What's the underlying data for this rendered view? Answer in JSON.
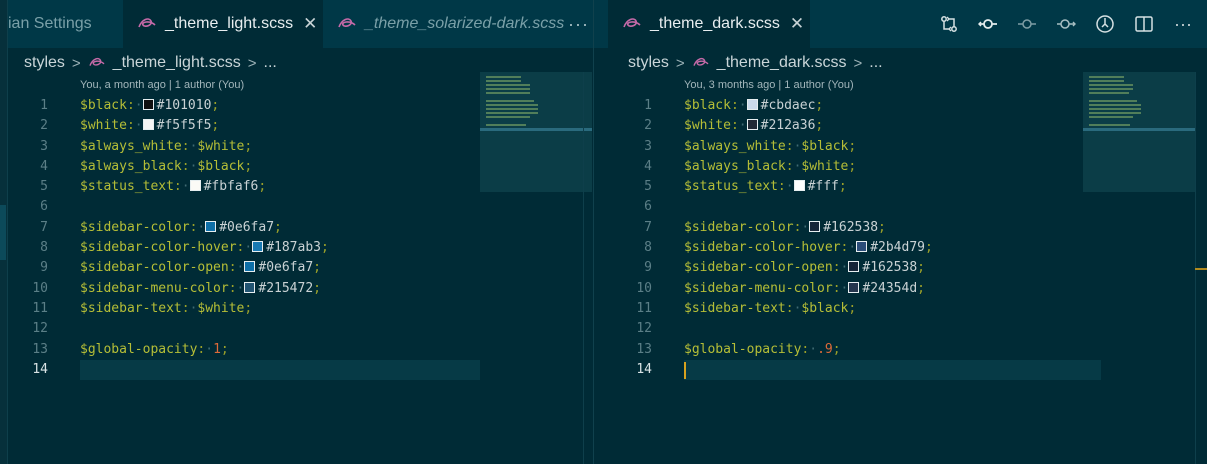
{
  "left": {
    "tabs": [
      {
        "label": "ian Settings",
        "active": false,
        "italic": false,
        "close": false
      },
      {
        "label": "_theme_light.scss",
        "active": true,
        "italic": false,
        "close": true
      },
      {
        "label": "_theme_solarized-dark.scss",
        "active": false,
        "italic": true,
        "close": false
      }
    ],
    "more": "···",
    "breadcrumb": {
      "folder": "styles",
      "file": "_theme_light.scss",
      "ellipsis": "..."
    },
    "blame": "You, a month ago | 1 author (You)",
    "lines": [
      {
        "n": "1",
        "var": "$black",
        "swatch": "#101010",
        "value": "#101010"
      },
      {
        "n": "2",
        "var": "$white",
        "swatch": "#f5f5f5",
        "value": "#f5f5f5"
      },
      {
        "n": "3",
        "var": "$always_white",
        "value": "$white"
      },
      {
        "n": "4",
        "var": "$always_black",
        "value": "$black"
      },
      {
        "n": "5",
        "var": "$status_text",
        "swatch": "#fbfaf6",
        "value": "#fbfaf6"
      },
      {
        "n": "6"
      },
      {
        "n": "7",
        "var": "$sidebar-color",
        "swatch": "#0e6fa7",
        "value": "#0e6fa7"
      },
      {
        "n": "8",
        "var": "$sidebar-color-hover",
        "swatch": "#187ab3",
        "value": "#187ab3"
      },
      {
        "n": "9",
        "var": "$sidebar-color-open",
        "swatch": "#0e6fa7",
        "value": "#0e6fa7"
      },
      {
        "n": "10",
        "var": "$sidebar-menu-color",
        "swatch": "#215472",
        "value": "#215472"
      },
      {
        "n": "11",
        "var": "$sidebar-text",
        "value": "$white"
      },
      {
        "n": "12"
      },
      {
        "n": "13",
        "var": "$global-opacity",
        "value": "1",
        "numeric": true
      },
      {
        "n": "14",
        "current": true
      }
    ]
  },
  "right": {
    "tab": {
      "label": "_theme_dark.scss",
      "close": true
    },
    "toolbar_icons": [
      "compare-changes-icon",
      "commit-icon",
      "previous-change-icon",
      "next-change-icon",
      "timeline-icon",
      "split-editor-icon",
      "more-actions-icon"
    ],
    "more": "···",
    "breadcrumb": {
      "folder": "styles",
      "file": "_theme_dark.scss",
      "ellipsis": "..."
    },
    "blame": "You, 3 months ago | 1 author (You)",
    "lines": [
      {
        "n": "1",
        "var": "$black",
        "swatch": "#cbdaec",
        "value": "#cbdaec"
      },
      {
        "n": "2",
        "var": "$white",
        "swatch": "#212a36",
        "value": "#212a36"
      },
      {
        "n": "3",
        "var": "$always_white",
        "value": "$black"
      },
      {
        "n": "4",
        "var": "$always_black",
        "value": "$white"
      },
      {
        "n": "5",
        "var": "$status_text",
        "swatch": "#ffffff",
        "value": "#fff"
      },
      {
        "n": "6"
      },
      {
        "n": "7",
        "var": "$sidebar-color",
        "swatch": "#162538",
        "value": "#162538"
      },
      {
        "n": "8",
        "var": "$sidebar-color-hover",
        "swatch": "#2b4d79",
        "value": "#2b4d79"
      },
      {
        "n": "9",
        "var": "$sidebar-color-open",
        "swatch": "#162538",
        "value": "#162538"
      },
      {
        "n": "10",
        "var": "$sidebar-menu-color",
        "swatch": "#24354d",
        "value": "#24354d"
      },
      {
        "n": "11",
        "var": "$sidebar-text",
        "value": "$black"
      },
      {
        "n": "12"
      },
      {
        "n": "13",
        "var": "$global-opacity",
        "value": ".9",
        "numeric": true
      },
      {
        "n": "14",
        "current": true
      }
    ]
  },
  "colors": {
    "background": "#002b36",
    "variable": "#b5be37",
    "number": "#dc6a3a",
    "caret": "#d7a21f",
    "sass_icon": "#c56aa8"
  }
}
